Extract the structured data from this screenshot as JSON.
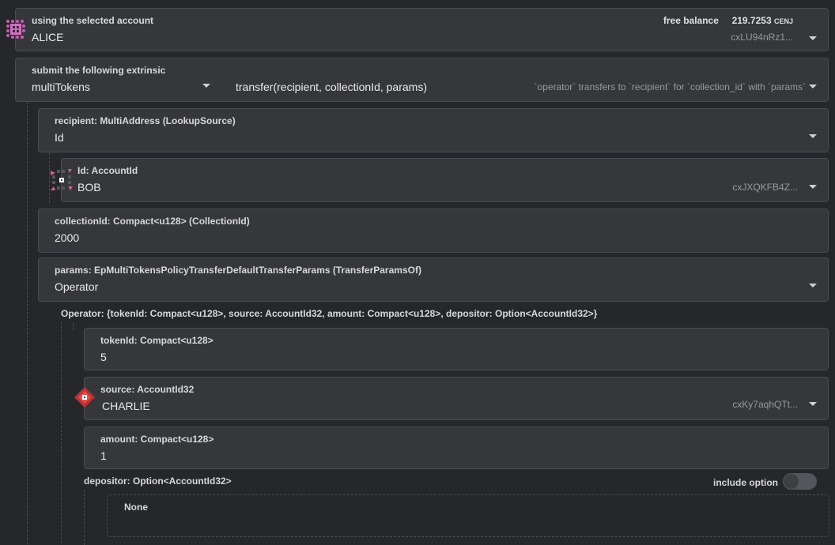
{
  "account": {
    "label": "using the selected account",
    "value": "ALICE",
    "free_balance_label": "free balance",
    "free_balance_value": "219.7253",
    "unit": "CENJ",
    "address": "cxLU94nRz1..."
  },
  "extrinsic": {
    "label": "submit the following extrinsic",
    "section": "multiTokens",
    "method": "transfer(recipient, collectionId, params)",
    "description": "`operator` transfers to `recipient` for `collection_id` with `params`"
  },
  "recipient": {
    "label": "recipient: MultiAddress (LookupSource)",
    "value": "Id"
  },
  "id": {
    "label": "Id: AccountId",
    "value": "BOB",
    "address": "cxJXQKFB4Z..."
  },
  "collection": {
    "label": "collectionId: Compact<u128> (CollectionId)",
    "value": "2000"
  },
  "params": {
    "label": "params: EpMultiTokensPolicyTransferDefaultTransferParams (TransferParamsOf)",
    "value": "Operator"
  },
  "operator": {
    "label": "Operator: {tokenId: Compact<u128>, source: AccountId32, amount: Compact<u128>, depositor: Option<AccountId32>}"
  },
  "token": {
    "label": "tokenId: Compact<u128>",
    "value": "5"
  },
  "source": {
    "label": "source: AccountId32",
    "value": "CHARLIE",
    "address": "cxKy7aqhQTt..."
  },
  "amount": {
    "label": "amount: Compact<u128>",
    "value": "1"
  },
  "depositor": {
    "label": "depositor: Option<AccountId32>",
    "include_label": "include option",
    "include_enabled": false,
    "none_label": "None"
  }
}
